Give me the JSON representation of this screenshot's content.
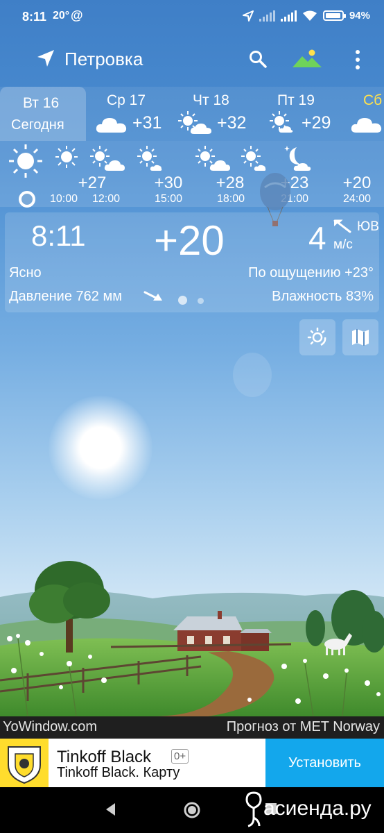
{
  "status_bar": {
    "time": "8:11",
    "temp": "20°",
    "at_icon": "@",
    "battery": "94%",
    "battery_level": 0.94,
    "icons": [
      "location-arrow-icon",
      "signal-icon",
      "signal-icon",
      "wifi-icon",
      "battery-icon"
    ]
  },
  "app_bar": {
    "location_icon": "navigation-arrow-icon",
    "city": "Петровка",
    "search_icon": "search-icon",
    "landscape_icon": "landscape-icon",
    "more_icon": "more-vertical-icon"
  },
  "days": [
    {
      "name": "Вт 16",
      "sub": "Сегодня",
      "selected": true
    },
    {
      "name": "Ср 17",
      "temp": "+31",
      "icon": "cloudy-icon"
    },
    {
      "name": "Чт 18",
      "temp": "+32",
      "icon": "partly-cloudy-icon"
    },
    {
      "name": "Пт 19",
      "temp": "+29",
      "icon": "partly-cloudy-icon"
    },
    {
      "name": "Сб",
      "icon": "cloudy-icon"
    }
  ],
  "hourly": [
    {
      "time": "10:00",
      "temp": "+27",
      "icon": "sun-icon"
    },
    {
      "time": "12:00",
      "temp": "",
      "icon": "sun-icon"
    },
    {
      "time": "15:00",
      "temp": "+30",
      "icon": "partly-cloudy-icon"
    },
    {
      "time": "18:00",
      "temp": "+28",
      "icon": "sun-icon"
    },
    {
      "time": "21:00",
      "temp": "+23",
      "icon": "partly-cloudy-icon"
    },
    {
      "time": "24:00",
      "temp": "+20",
      "icon": "sun-icon"
    }
  ],
  "current": {
    "time": "8:11",
    "temp": "+20",
    "wind_speed": "4",
    "wind_dir": "ЮВ",
    "wind_unit": "м/с",
    "condition": "Ясно",
    "feels_like": "По ощущению +23°",
    "pressure": "Давление 762 мм",
    "humidity": "Влажность 83%"
  },
  "side_buttons": [
    "sun-radar-icon",
    "map-icon"
  ],
  "credit": {
    "left": "YoWindow.com",
    "right": "Прогноз от MET Norway"
  },
  "ad": {
    "title": "Tinkoff Black",
    "age": "0+",
    "subtitle": "Tinkoff Black. Карту",
    "button": "Установить",
    "brand_color": "#ffdd2d",
    "button_color": "#13a7ec"
  },
  "watermark": "асиенда.ру",
  "nav_bar": [
    "back-icon",
    "home-icon",
    "recents-icon"
  ]
}
